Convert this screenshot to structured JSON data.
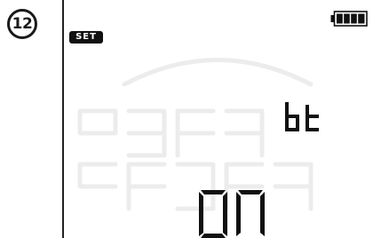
{
  "step": {
    "number": "12"
  },
  "display": {
    "mode_badge": "SET",
    "parameter": "bt",
    "value": "on",
    "battery_level_fraction": 1.0
  },
  "colors": {
    "segment_on": "#111111",
    "segment_ghost": "#ececec",
    "badge_bg": "#111111",
    "badge_text": "#ffffff"
  },
  "icons": {
    "battery": "battery-full-icon"
  }
}
